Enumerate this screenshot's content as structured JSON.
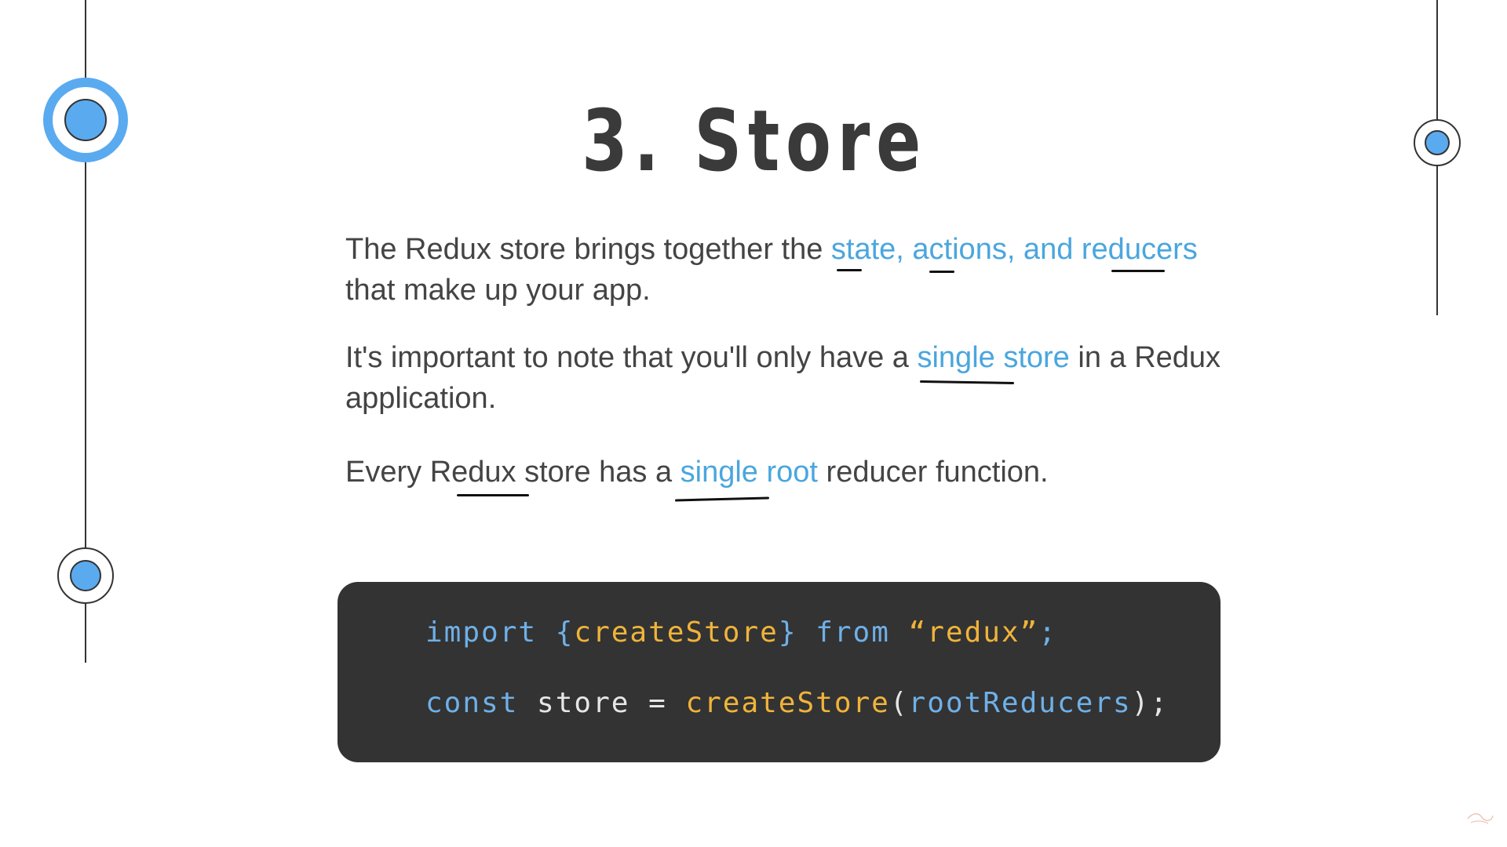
{
  "slide": {
    "title": "3. Store",
    "paragraphs": {
      "p1": {
        "lead": "The Redux store brings together the ",
        "highlight": "state, actions, and reducers",
        "tail": "that make up your app."
      },
      "p2": {
        "lead": "It's important to note that you'll only have a ",
        "highlight": "single store",
        "tail_inline": " in a Redux",
        "tail": "application."
      },
      "p3": {
        "lead": "Every Redux store has a ",
        "highlight": "single root",
        "tail": " reducer function."
      }
    },
    "code": {
      "line1": {
        "kw_import": "import ",
        "brace_open": "{",
        "fn_name": "createStore",
        "brace_close": "}",
        "kw_from": " from ",
        "str": "“redux”",
        "semi": ";"
      },
      "line2": {
        "kw_const": "const ",
        "ident": "store = ",
        "fn_name": "createStore",
        "paren_open": "(",
        "arg": "rootReducers",
        "paren_close": ");"
      }
    },
    "colors": {
      "accent": "#5aaaf0",
      "highlight_text": "#4aa6de",
      "code_bg": "#333333",
      "code_keyword": "#6fb0e8",
      "code_function": "#f0b43a"
    }
  }
}
